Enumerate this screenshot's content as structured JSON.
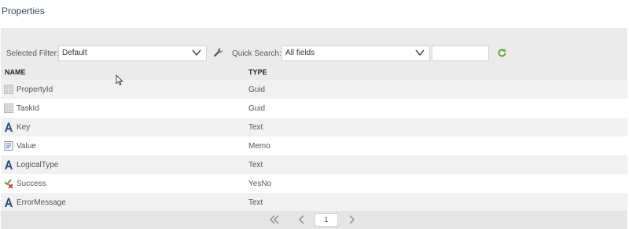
{
  "page": {
    "title": "Properties"
  },
  "toolbar": {
    "filter_label": "Selected Filter:",
    "filter_value": "Default",
    "quick_search_label": "Quick Search:",
    "quick_search_field": "All fields",
    "quick_search_text": ""
  },
  "grid": {
    "columns": [
      "NAME",
      "TYPE"
    ],
    "rows": [
      {
        "name": "PropertyId",
        "type": "Guid",
        "icon": "guid-icon"
      },
      {
        "name": "TaskId",
        "type": "Guid",
        "icon": "guid-icon"
      },
      {
        "name": "Key",
        "type": "Text",
        "icon": "text-icon"
      },
      {
        "name": "Value",
        "type": "Memo",
        "icon": "memo-icon"
      },
      {
        "name": "LogicalType",
        "type": "Text",
        "icon": "text-icon"
      },
      {
        "name": "Success",
        "type": "YesNo",
        "icon": "yesno-icon"
      },
      {
        "name": "ErrorMessage",
        "type": "Text",
        "icon": "text-icon"
      }
    ]
  },
  "pager": {
    "current_page": "1"
  },
  "colors": {
    "accent_green": "#5a9a2a",
    "text_icon_blue": "#2b4a78"
  }
}
